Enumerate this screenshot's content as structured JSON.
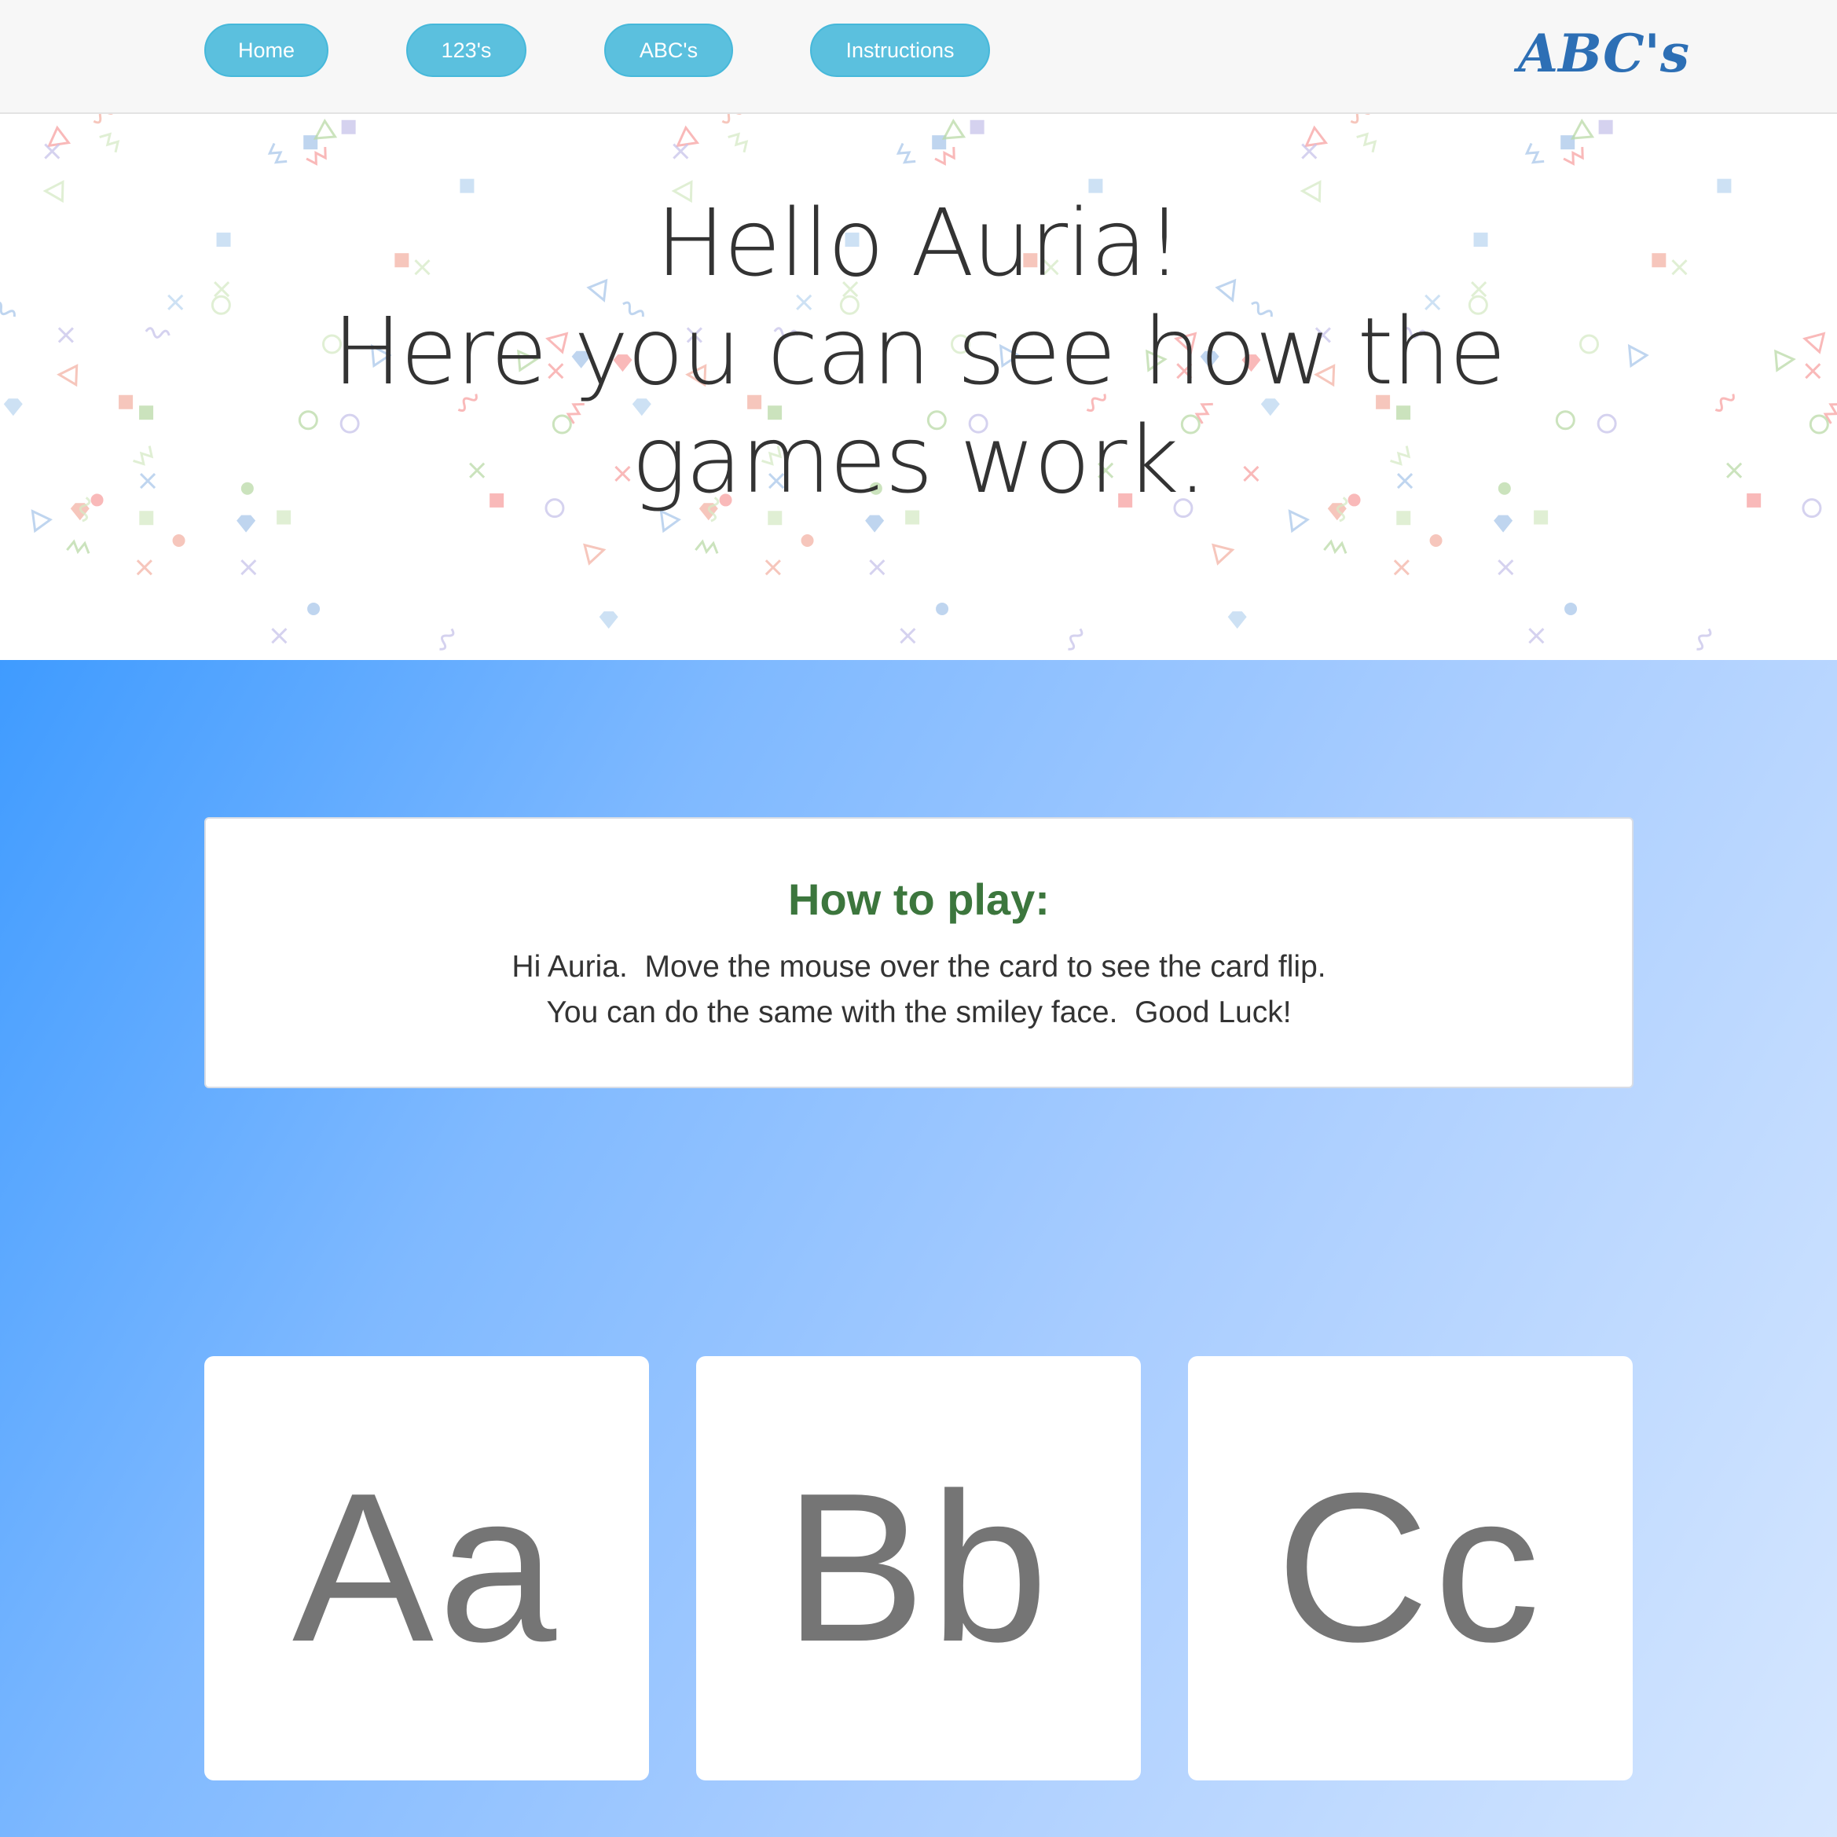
{
  "navbar": {
    "items": [
      {
        "label": "Home"
      },
      {
        "label": "123's"
      },
      {
        "label": "ABC's"
      },
      {
        "label": "Instructions"
      }
    ],
    "brand": "ABC's"
  },
  "hero": {
    "line1": "Hello Auria!",
    "line2": "Here you can see how the games work."
  },
  "howto": {
    "title": "How to play:",
    "line1": "Hi Auria.  Move the mouse over the card to see the card flip.",
    "line2": "You can do the same with the smiley face.  Good Luck!"
  },
  "cards": [
    {
      "letters": "Aa"
    },
    {
      "letters": "Bb"
    },
    {
      "letters": "Cc"
    }
  ],
  "colors": {
    "nav_button": "#5bc0de",
    "brand": "#2d6fb5",
    "howto_title": "#3c763d",
    "card_letter": "#757575",
    "gradient_start": "#3f9bff",
    "gradient_end": "#d6e7ff"
  }
}
